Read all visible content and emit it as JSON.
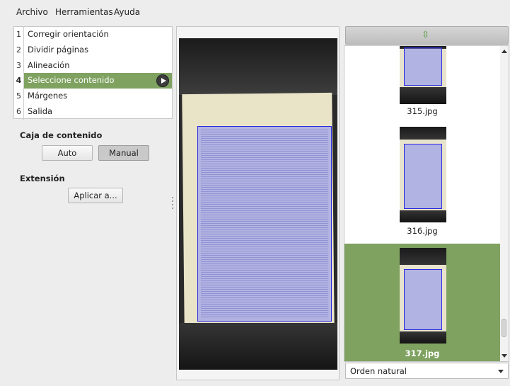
{
  "menu": {
    "file": "Archivo",
    "tools": "Herramientas",
    "help": "Ayuda"
  },
  "stages": [
    {
      "num": "1",
      "label": "Corregir orientación"
    },
    {
      "num": "2",
      "label": "Dividir páginas"
    },
    {
      "num": "3",
      "label": "Alineación"
    },
    {
      "num": "4",
      "label": "Seleccione contenido"
    },
    {
      "num": "5",
      "label": "Márgenes"
    },
    {
      "num": "6",
      "label": "Salida"
    }
  ],
  "selected_stage": "4",
  "content_box": {
    "title": "Caja de contenido",
    "auto": "Auto",
    "manual": "Manual",
    "active_mode": "Manual"
  },
  "extension": {
    "title": "Extensión",
    "apply": "Aplicar a..."
  },
  "thumbnails": [
    {
      "caption": "315.jpg",
      "selected": false
    },
    {
      "caption": "316.jpg",
      "selected": false
    },
    {
      "caption": "317.jpg",
      "selected": true
    }
  ],
  "sort": {
    "selected": "Orden natural"
  },
  "colors": {
    "accent": "#7fa260",
    "content_box": "#2a2ae0"
  },
  "icons": {
    "thumb_header": "refresh-arrows-icon",
    "run": "play-icon"
  }
}
